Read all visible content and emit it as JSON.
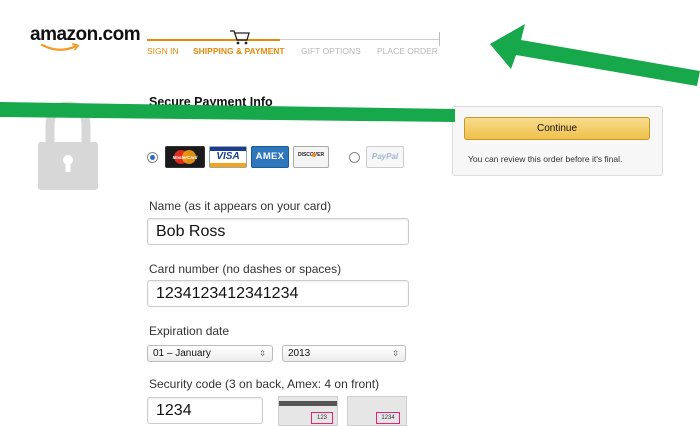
{
  "header": {
    "logo_text": "amazon.com",
    "steps": [
      {
        "label": "SIGN IN",
        "state": "done"
      },
      {
        "label": "SHIPPING & PAYMENT",
        "state": "active"
      },
      {
        "label": "GIFT OPTIONS",
        "state": "todo"
      },
      {
        "label": "PLACE ORDER",
        "state": "todo"
      }
    ],
    "cart_icon": "cart-icon"
  },
  "payment": {
    "title": "Secure Payment Info",
    "methods": [
      {
        "name": "MasterCard",
        "selected": true
      },
      {
        "name": "VISA"
      },
      {
        "name": "AMEX"
      },
      {
        "name": "DISCOVER"
      },
      {
        "name": "PayPal",
        "selected": false
      }
    ],
    "name_label": "Name (as it appears on your card)",
    "name_value": "Bob Ross",
    "card_label": "Card number (no dashes or spaces)",
    "card_value": "1234123412341234",
    "exp_label": "Expiration date",
    "exp_month": "01 – January",
    "exp_year": "2013",
    "cvv_label": "Security code (3 on back, Amex: 4 on front)",
    "cvv_value": "1234",
    "cvv_hint_back": "123",
    "cvv_hint_front": "1234"
  },
  "sidebar": {
    "continue_label": "Continue",
    "review_note": "You can review this order before it's final."
  },
  "colors": {
    "brand_orange": "#e8890c",
    "button_yellow": "#f0c14b",
    "annotation_green": "#16a84a"
  }
}
